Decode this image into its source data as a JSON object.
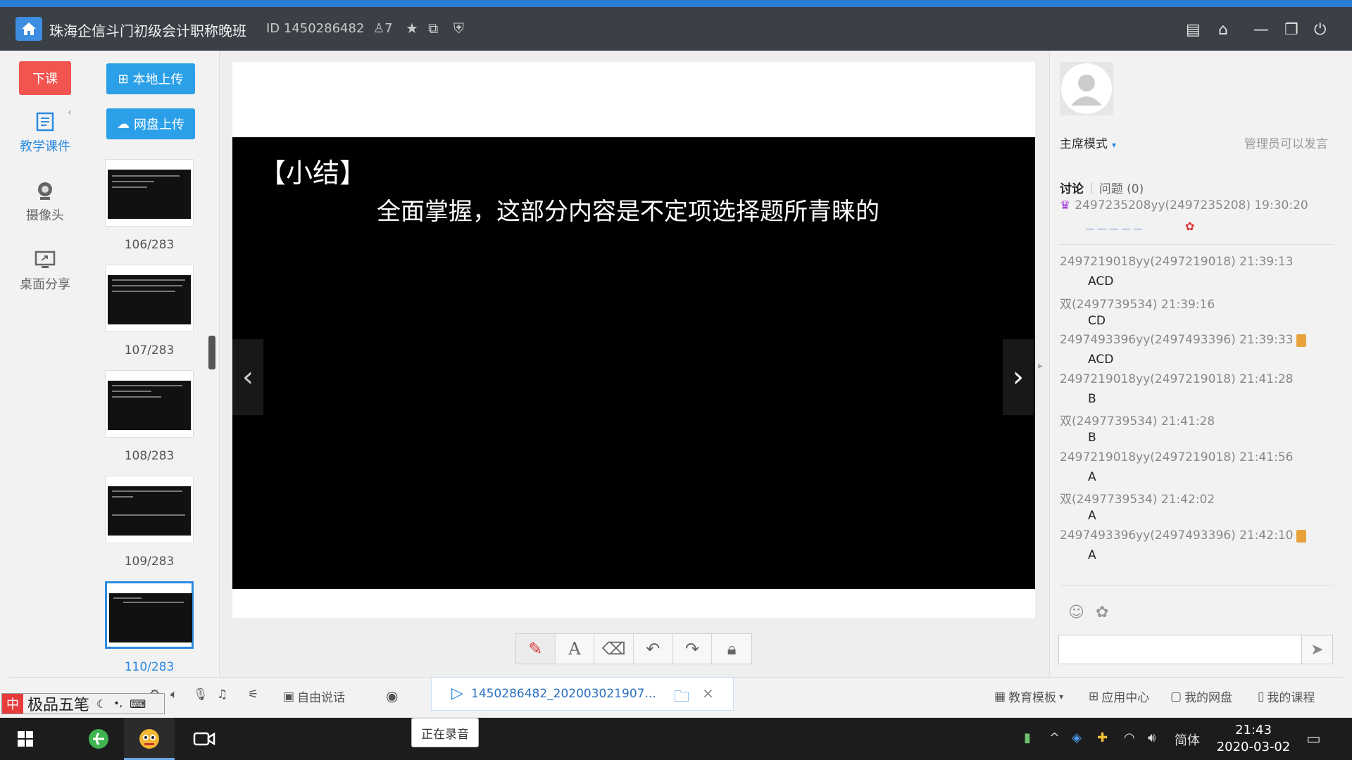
{
  "window": {
    "title": "珠海企信斗门初级会计职称晚班",
    "id_text": "ID 1450286482",
    "member_count": "7"
  },
  "nav": {
    "end_class": "下课",
    "items": [
      {
        "label": "教学课件",
        "icon": "courseware-icon"
      },
      {
        "label": "摄像头",
        "icon": "camera-icon"
      },
      {
        "label": "桌面分享",
        "icon": "screen-share-icon"
      }
    ]
  },
  "uploads": {
    "local": "本地上传",
    "cloud": "网盘上传"
  },
  "thumbnails": [
    {
      "label": "106/283"
    },
    {
      "label": "107/283"
    },
    {
      "label": "108/283"
    },
    {
      "label": "109/283"
    },
    {
      "label": "110/283"
    }
  ],
  "slide": {
    "heading": "【小结】",
    "text": "全面掌握，这部分内容是不定项选择题所青睐的"
  },
  "right": {
    "mode": "主席模式",
    "admin_hint": "管理员可以发言",
    "tab_discussion": "讨论",
    "tab_questions": "问题 (0)",
    "pinned_meta": "2497235208yy(2497235208) 19:30:20"
  },
  "messages": [
    {
      "meta": "2497219018yy(2497219018) 21:39:13",
      "body": "ACD",
      "badge": false
    },
    {
      "meta": "双(2497739534) 21:39:16",
      "body": "CD",
      "badge": false
    },
    {
      "meta": "2497493396yy(2497493396) 21:39:33",
      "body": "ACD",
      "badge": true
    },
    {
      "meta": "2497219018yy(2497219018) 21:41:28",
      "body": "B",
      "badge": false
    },
    {
      "meta": "双(2497739534) 21:41:28",
      "body": "B",
      "badge": false
    },
    {
      "meta": "2497219018yy(2497219018) 21:41:56",
      "body": "A",
      "badge": false
    },
    {
      "meta": "双(2497739534) 21:42:02",
      "body": "A",
      "badge": false
    },
    {
      "meta": "2497493396yy(2497493396) 21:42:10",
      "body": "A",
      "badge": true
    }
  ],
  "bottom": {
    "free_talk": "自由说话",
    "recording_file": "1450286482_202003021907...",
    "recording_tooltip": "正在录音",
    "templates": "教育模板",
    "app_center": "应用中心",
    "my_drive": "我的网盘",
    "my_courses": "我的课程"
  },
  "ime": {
    "name": "极品五笔"
  },
  "taskbar": {
    "lang": "简体",
    "time": "21:43",
    "date": "2020-03-02"
  },
  "colors": {
    "accent": "#2a8ae0",
    "end_class": "#f2544f",
    "upload": "#2ba0e8"
  }
}
